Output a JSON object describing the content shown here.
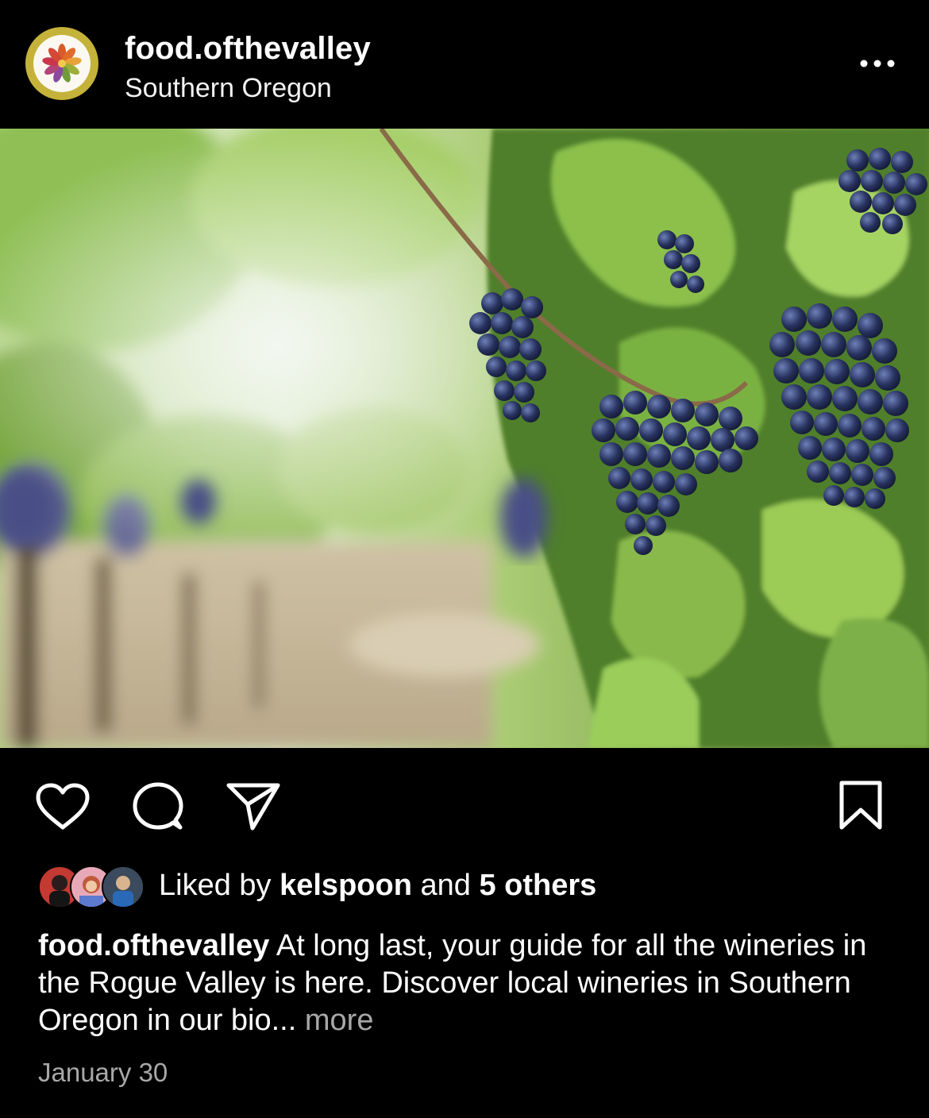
{
  "post": {
    "username": "food.ofthevalley",
    "location": "Southern Oregon",
    "more_menu_icon": "ellipsis-icon",
    "photo_alt": "Vineyard with grape clusters"
  },
  "actions": {
    "like_icon": "heart-icon",
    "comment_icon": "comment-icon",
    "share_icon": "paper-plane-icon",
    "save_icon": "bookmark-icon"
  },
  "likes": {
    "prefix": "Liked by",
    "user": "kelspoon",
    "conjunction": "and",
    "others": "5 others"
  },
  "caption": {
    "username": "food.ofthevalley",
    "text": "At long last, your guide for all the wineries in the Rogue Valley is here. Discover local wineries in Southern Oregon in our bio...",
    "more_label": "more"
  },
  "timestamp": "January 30",
  "colors": {
    "background": "#000000",
    "text": "#ffffff",
    "secondary_text": "#a8a8a8",
    "avatar_ring": "#c4b23a"
  }
}
